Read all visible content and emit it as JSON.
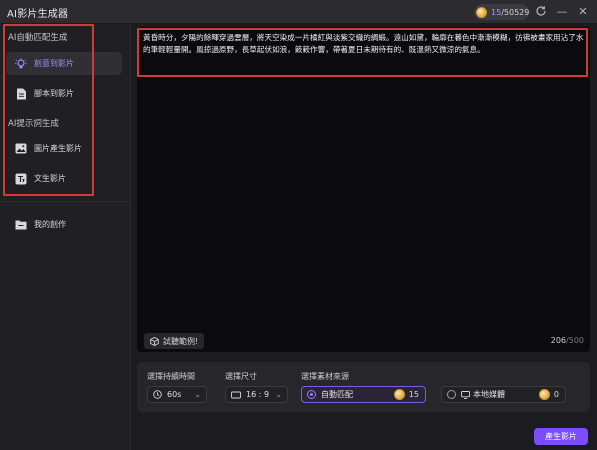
{
  "window": {
    "title": "AI影片生成器",
    "credits_used": "15",
    "credits_total": "/50529",
    "minimize": "—",
    "close": "✕"
  },
  "sidebar": {
    "section1_title": "AI自動匹配生成",
    "section1_items": [
      {
        "label": "創意到影片",
        "icon": "bulb-icon",
        "active": true
      },
      {
        "label": "腳本到影片",
        "icon": "document-icon",
        "active": false
      }
    ],
    "section2_title": "AI提示詞生成",
    "section2_items": [
      {
        "label": "圖片產生影片",
        "icon": "image-icon",
        "active": false
      },
      {
        "label": "文生影片",
        "icon": "text-icon",
        "active": false
      }
    ],
    "my_works": {
      "label": "我的創作",
      "icon": "folder-icon"
    }
  },
  "editor": {
    "text": "黃昏時分，夕陽的餘暉穿過雲層，將天空染成一片橘紅與淡紫交織的綢緞。遠山如黛，輪廓在暮色中漸漸模糊，彷彿被畫家用沾了水的筆輕輕暈開。風掠過原野，長草起伏如浪，簌簌作響，帶著夏日未期待有的、既溫熱又微涼的氣息。",
    "example_button": "試聽範例!",
    "char_count": "206",
    "char_max": "/500"
  },
  "options": {
    "duration_label": "選擇持續時間",
    "duration_value": "60s",
    "size_label": "選擇尺寸",
    "size_value": "16 : 9",
    "source_label": "選擇素材來源",
    "source_auto_label": "自動匹配",
    "source_auto_cost": "15",
    "source_local_label": "本地媒體",
    "source_local_cost": "0"
  },
  "actions": {
    "generate": "產生影片"
  },
  "colors": {
    "accent": "#7c4dff",
    "highlight_box": "#d23a3a"
  }
}
